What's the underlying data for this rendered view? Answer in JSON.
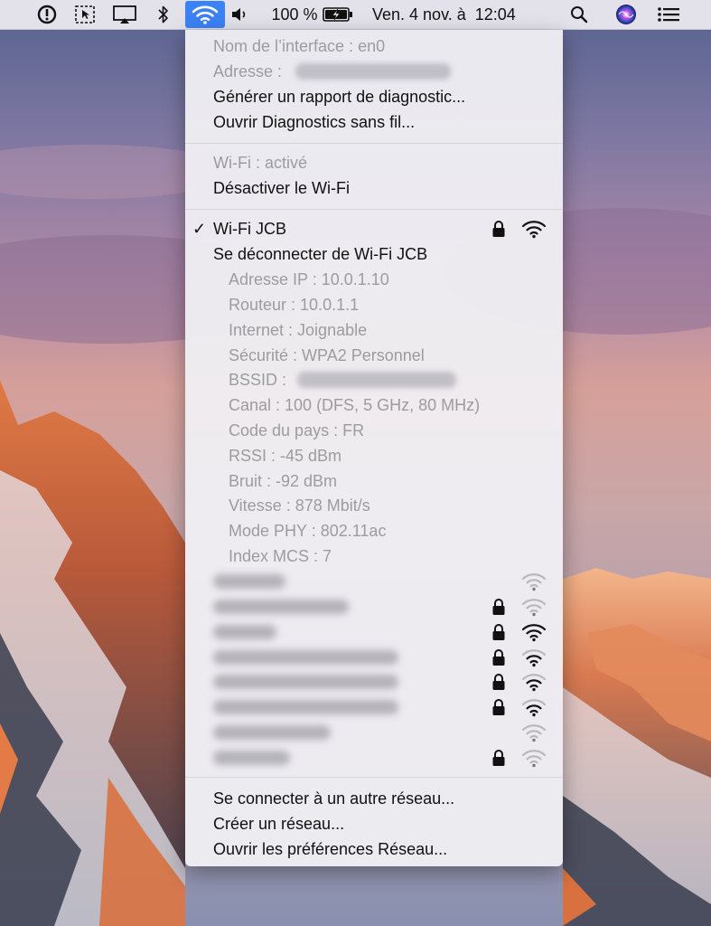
{
  "menubar": {
    "battery_percent": "100 %",
    "clock": "Ven. 4 nov. à  12:04",
    "icons": [
      "vpn-icon",
      "screenshot-icon",
      "airplay-icon",
      "bluetooth-icon",
      "wifi-icon",
      "volume-icon",
      "battery-charging-icon",
      "spotlight-search-icon",
      "siri-icon",
      "notification-center-icon"
    ]
  },
  "menu": {
    "interface_name": "Nom de l’interface : en0",
    "address_label": "Adresse :",
    "diagnostic_report": "Générer un rapport de diagnostic...",
    "open_diagnostics": "Ouvrir Diagnostics sans fil...",
    "wifi_status": "Wi-Fi : activé",
    "wifi_disable": "Désactiver le Wi-Fi",
    "current_network": "Wi-Fi JCB",
    "checkmark": "✓",
    "disconnect": "Se déconnecter de Wi-Fi JCB",
    "details": [
      "Adresse IP : 10.0.1.10",
      "Routeur : 10.0.1.1",
      "Internet : Joignable",
      "Sécurité : WPA2 Personnel",
      "BSSID :",
      "Canal : 100 (DFS, 5 GHz, 80 MHz)",
      "Code du pays : FR",
      "RSSI : -45 dBm",
      "Bruit : -92 dBm",
      "Vitesse : 878 Mbit/s",
      "Mode PHY : 802.11ac",
      "Index MCS : 7"
    ],
    "other_networks": [
      {
        "locked": false,
        "signal": "weak"
      },
      {
        "locked": true,
        "signal": "weak"
      },
      {
        "locked": true,
        "signal": "strong"
      },
      {
        "locked": true,
        "signal": "medium"
      },
      {
        "locked": true,
        "signal": "medium"
      },
      {
        "locked": true,
        "signal": "medium"
      },
      {
        "locked": false,
        "signal": "weak"
      },
      {
        "locked": true,
        "signal": "weak"
      }
    ],
    "join_other": "Se connecter à un autre réseau...",
    "create_network": "Créer un réseau...",
    "open_prefs": "Ouvrir les préférences Réseau..."
  },
  "colors": {
    "accent": "#3b82f6",
    "menu_bg": "#efeef2",
    "disabled_text": "#9c9ca0"
  }
}
